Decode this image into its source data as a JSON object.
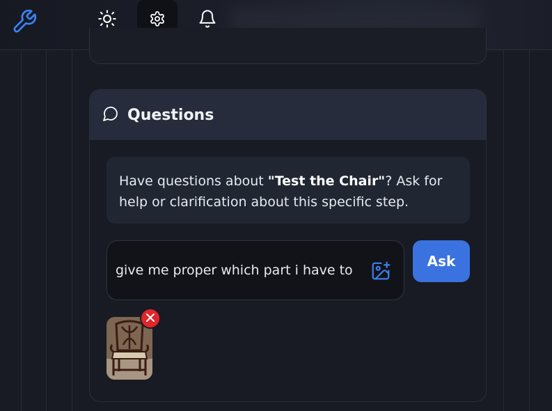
{
  "toolbar": {
    "logo_icon": "wrench-icon",
    "buttons": [
      {
        "name": "theme-toggle",
        "icon": "sun-icon"
      },
      {
        "name": "settings",
        "icon": "gear-icon",
        "active": true
      },
      {
        "name": "notifications",
        "icon": "bell-icon"
      }
    ]
  },
  "questions": {
    "title": "Questions",
    "icon": "chat-bubble-icon",
    "info_prefix": "Have questions about ",
    "info_step": "\"Test the Chair\"",
    "info_suffix": "? Ask for help or clarification about this specific step.",
    "input_value": "give me proper which part i have to re",
    "attach_icon": "image-add-icon",
    "ask_label": "Ask",
    "attachments": [
      {
        "type": "image",
        "subject": "wooden chair photo",
        "remove_icon": "close-icon"
      }
    ]
  },
  "colors": {
    "background": "#181b24",
    "card_header": "#262c3b",
    "accent": "#3a72df",
    "remove": "#e0262b",
    "logo": "#3b82f6"
  }
}
